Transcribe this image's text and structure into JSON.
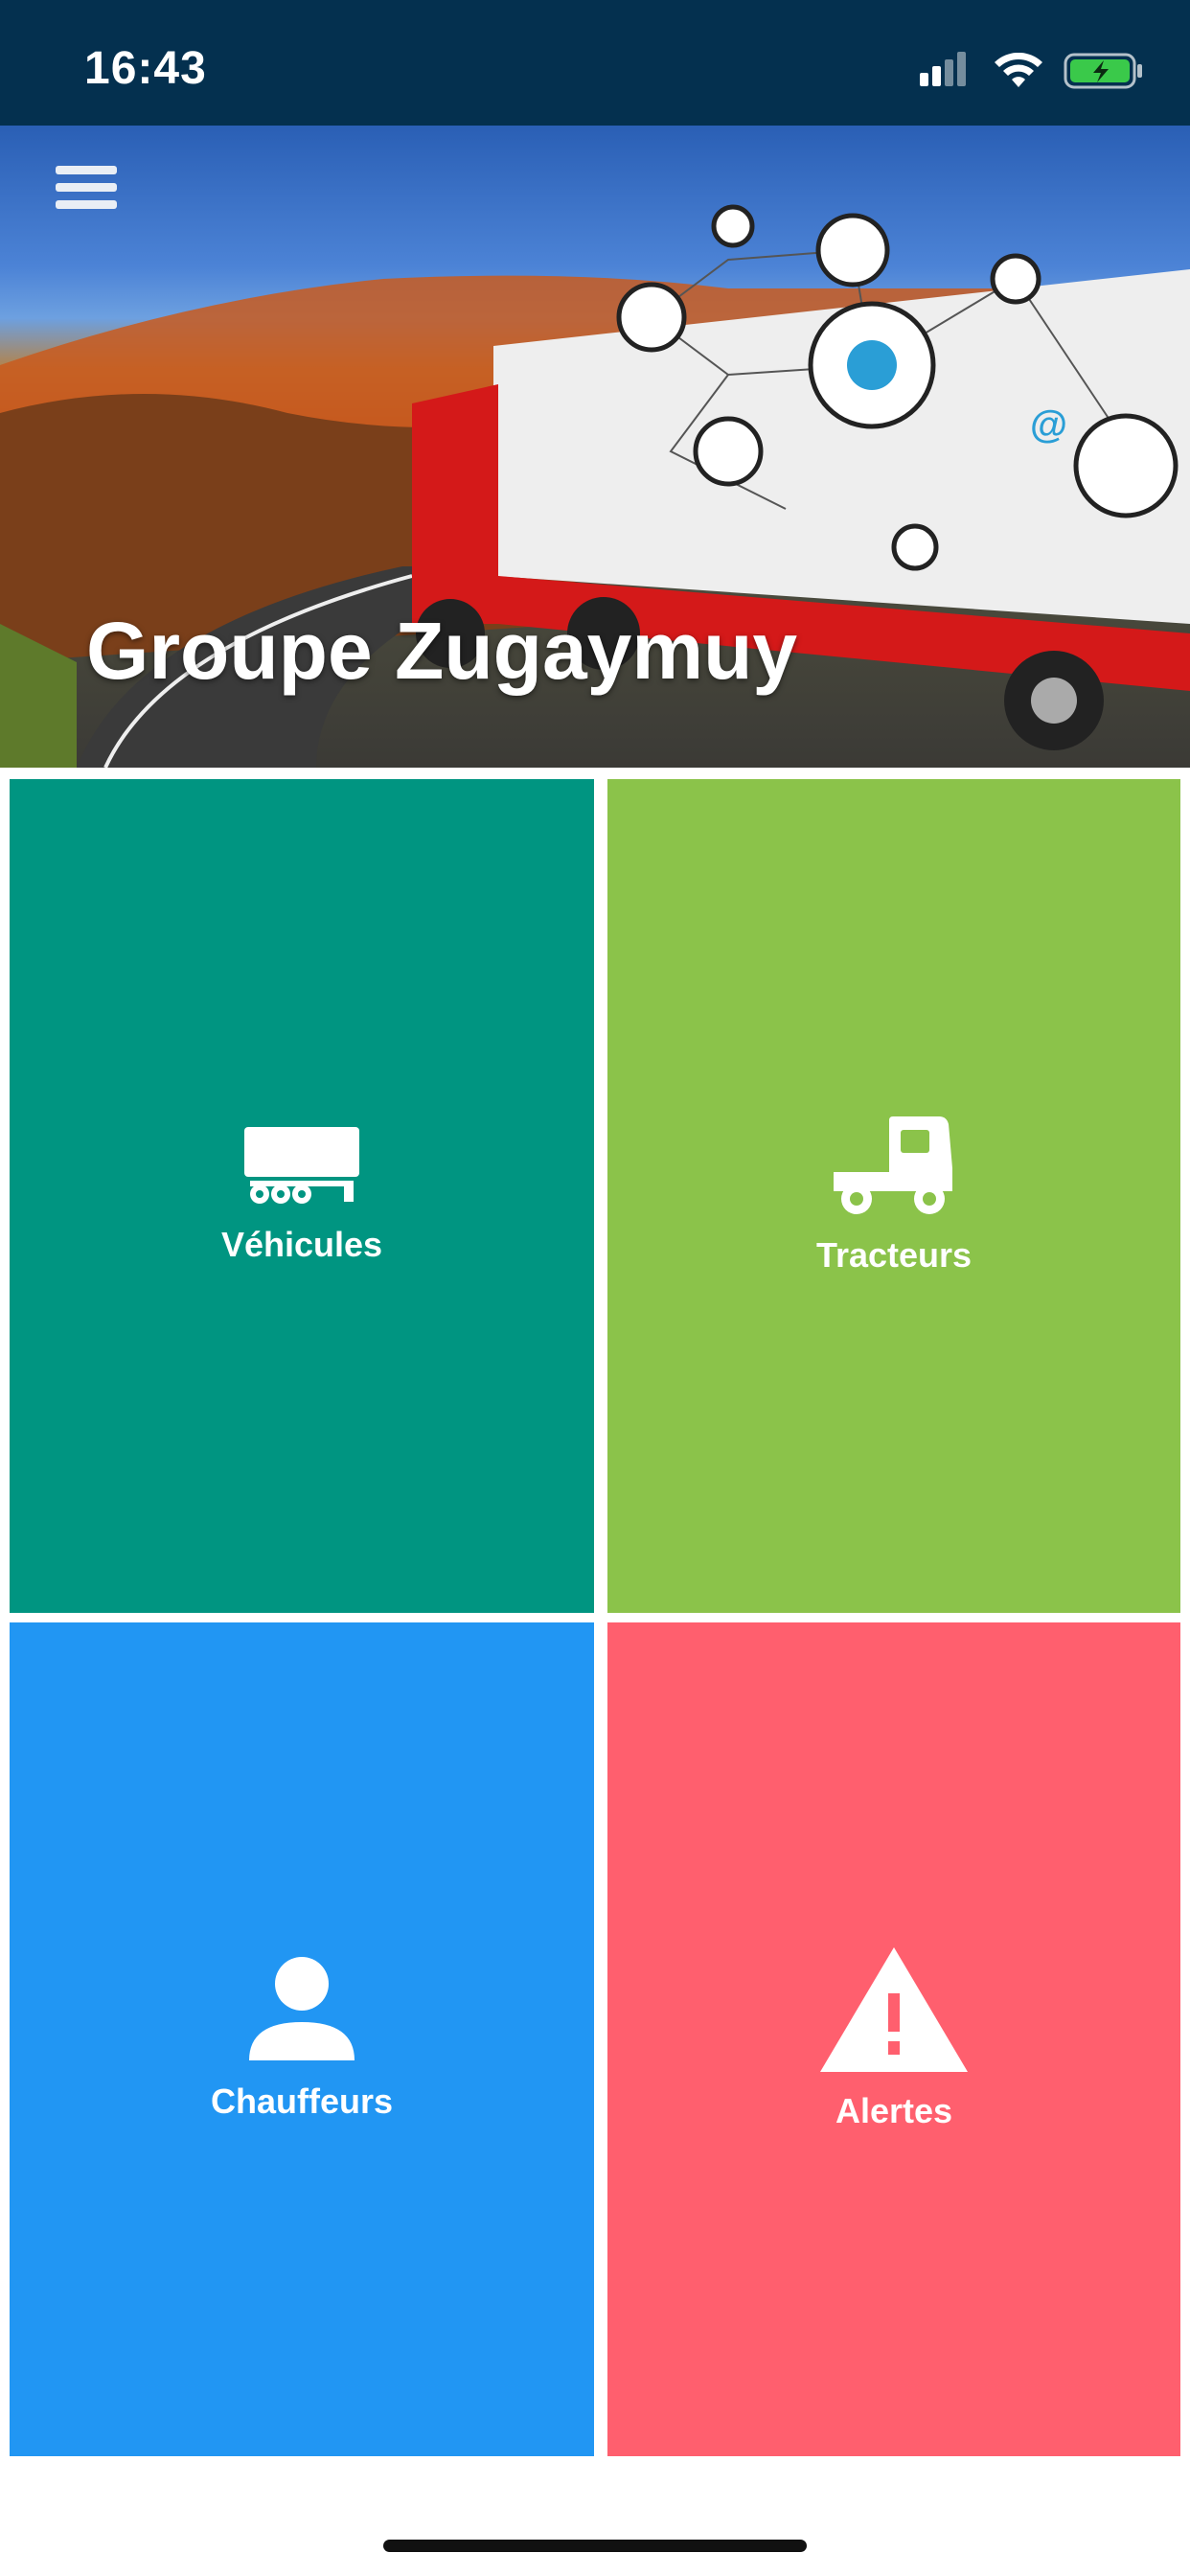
{
  "status_bar": {
    "time": "16:43",
    "icons": [
      "cellular-signal-icon",
      "wifi-icon",
      "battery-charging-icon"
    ]
  },
  "hero": {
    "title": "Groupe Zugaymuy",
    "menu_icon": "hamburger-menu-icon",
    "image": "red-truck-on-autumn-road-image"
  },
  "tiles": [
    {
      "label": "Véhicules",
      "icon": "trailer-icon",
      "color": "#009581"
    },
    {
      "label": "Tracteurs",
      "icon": "tractor-truck-icon",
      "color": "#8bc34a"
    },
    {
      "label": "Chauffeurs",
      "icon": "person-icon",
      "color": "#2196f3"
    },
    {
      "label": "Alertes",
      "icon": "warning-icon",
      "color": "#ff5f6e"
    }
  ]
}
